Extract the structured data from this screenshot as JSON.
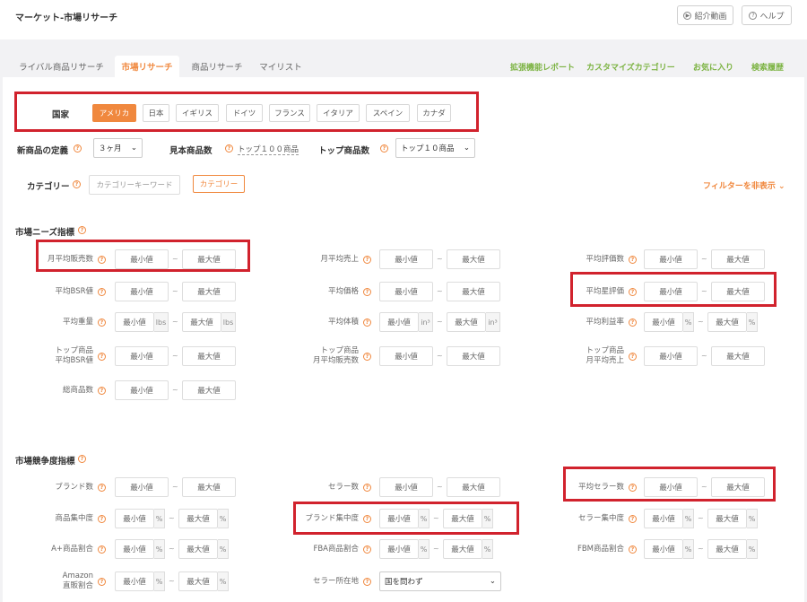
{
  "header": {
    "title": "マーケット-市場リサーチ",
    "video_btn": "紹介動画",
    "help_btn": "ヘルプ"
  },
  "tabs": [
    "ライバル商品リサーチ",
    "市場リサーチ",
    "商品リサーチ",
    "マイリスト"
  ],
  "right_links": [
    "拡張機能レポート",
    "カスタマイズカテゴリー",
    "お気に入り",
    "検索履歴"
  ],
  "country": {
    "label": "国家",
    "options": [
      "アメリカ",
      "日本",
      "イギリス",
      "ドイツ",
      "フランス",
      "イタリア",
      "スペイン",
      "カナダ"
    ],
    "selected": "アメリカ"
  },
  "filters": {
    "new_def_label": "新商品の定義",
    "new_def_value": "３ヶ月",
    "sample_label": "見本商品数",
    "sample_value": "トップ１００商品",
    "top_label": "トップ商品数",
    "top_value": "トップ１０商品",
    "category_label": "カテゴリー",
    "category_placeholder": "カテゴリーキーワード",
    "category_btn": "カテゴリー",
    "hide_filter": "フィルターを非表示"
  },
  "common": {
    "min": "最小値",
    "max": "最大値",
    "tilde": "~",
    "lbs": "lbs",
    "in3": "in³",
    "pct": "%"
  },
  "demand": {
    "title": "市場ニーズ指標",
    "labels": [
      "月平均販売数",
      "月平均売上",
      "平均評価数",
      "平均BSR値",
      "平均価格",
      "平均星評価",
      "平均重量",
      "平均体積",
      "平均利益率",
      "トップ商品\n平均BSR値",
      "トップ商品\n月平均販売数",
      "トップ商品\n月平均売上",
      "総商品数"
    ]
  },
  "competition": {
    "title": "市場競争度指標",
    "labels": [
      "ブランド数",
      "セラー数",
      "平均セラー数",
      "商品集中度",
      "ブランド集中度",
      "セラー集中度",
      "A+商品割合",
      "FBA商品割合",
      "FBM商品割合",
      "Amazon\n直販割合",
      "セラー所在地"
    ],
    "seller_location": "国を問わず"
  }
}
